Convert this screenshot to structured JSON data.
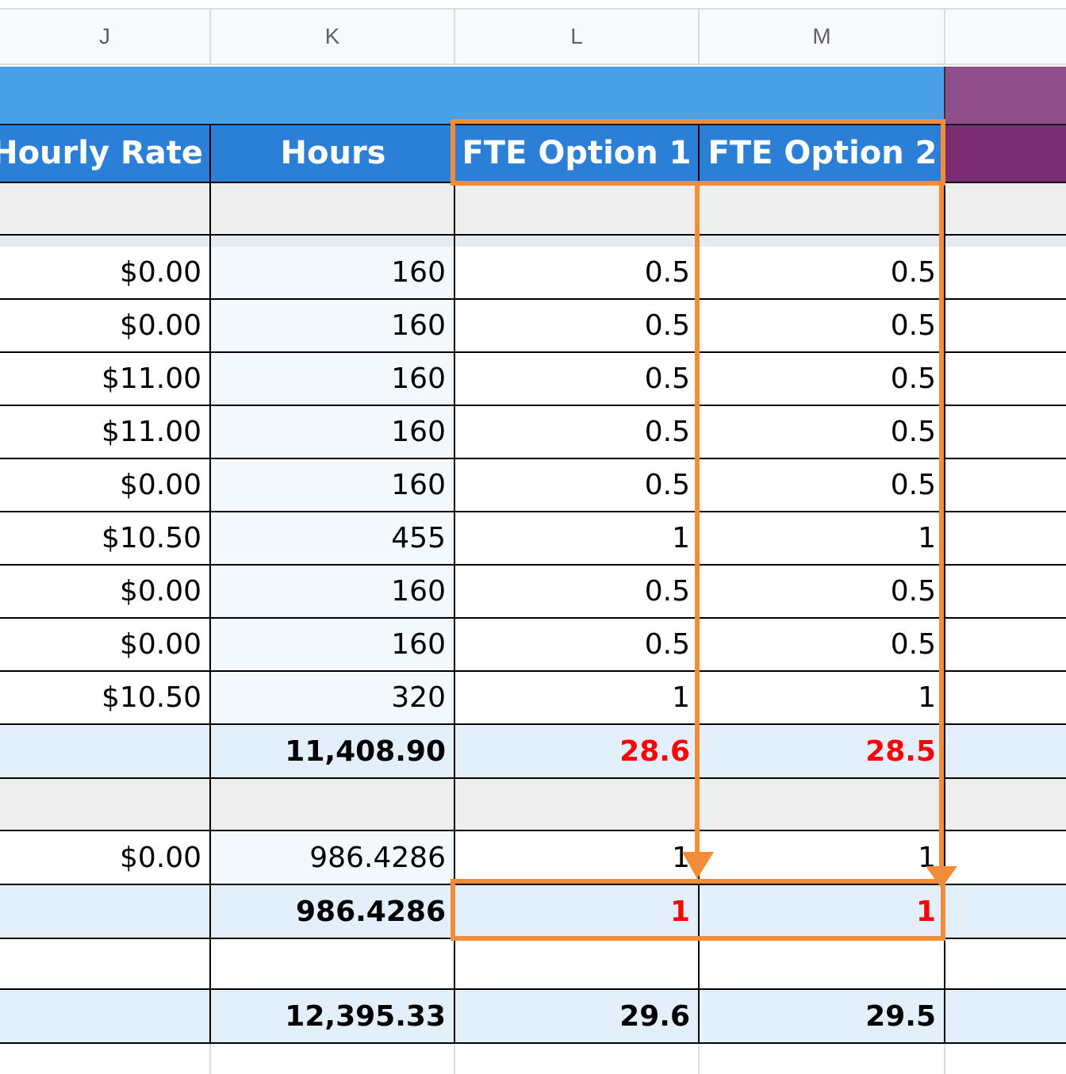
{
  "columns": [
    "J",
    "K",
    "L",
    "M"
  ],
  "headers": {
    "hourly_rate": "e Hourly Rate",
    "hours": "Hours",
    "fte1": "FTE Option 1",
    "fte2": "FTE Option 2"
  },
  "rows": [
    {
      "rate": "$0.00",
      "hours": "160",
      "fte1": "0.5",
      "fte2": "0.5"
    },
    {
      "rate": "$0.00",
      "hours": "160",
      "fte1": "0.5",
      "fte2": "0.5"
    },
    {
      "rate": "$11.00",
      "hours": "160",
      "fte1": "0.5",
      "fte2": "0.5"
    },
    {
      "rate": "$11.00",
      "hours": "160",
      "fte1": "0.5",
      "fte2": "0.5"
    },
    {
      "rate": "$0.00",
      "hours": "160",
      "fte1": "0.5",
      "fte2": "0.5"
    },
    {
      "rate": "$10.50",
      "hours": "455",
      "fte1": "1",
      "fte2": "1"
    },
    {
      "rate": "$0.00",
      "hours": "160",
      "fte1": "0.5",
      "fte2": "0.5"
    },
    {
      "rate": "$0.00",
      "hours": "160",
      "fte1": "0.5",
      "fte2": "0.5"
    },
    {
      "rate": "$10.50",
      "hours": "320",
      "fte1": "1",
      "fte2": "1"
    }
  ],
  "subtotal1": {
    "hours": "11,408.90",
    "fte1": "28.6",
    "fte2": "28.5"
  },
  "section2_row": {
    "rate": "$0.00",
    "hours": "986.4286",
    "fte1": "1",
    "fte2": "1"
  },
  "subtotal2": {
    "hours": "986.4286",
    "fte1": "1",
    "fte2": "1"
  },
  "grand_total": {
    "hours": "12,395.33",
    "fte1": "29.6",
    "fte2": "29.5"
  },
  "colors": {
    "header_blue_top": "#4aa0e6",
    "header_blue": "#2c7fd6",
    "purple_top": "#8e4f8a",
    "purple": "#7b2d74",
    "highlight_orange": "#f28c38",
    "total_fill": "#e3f0fb",
    "section_gray": "#eeeeee",
    "error_red": "#ff0000"
  }
}
